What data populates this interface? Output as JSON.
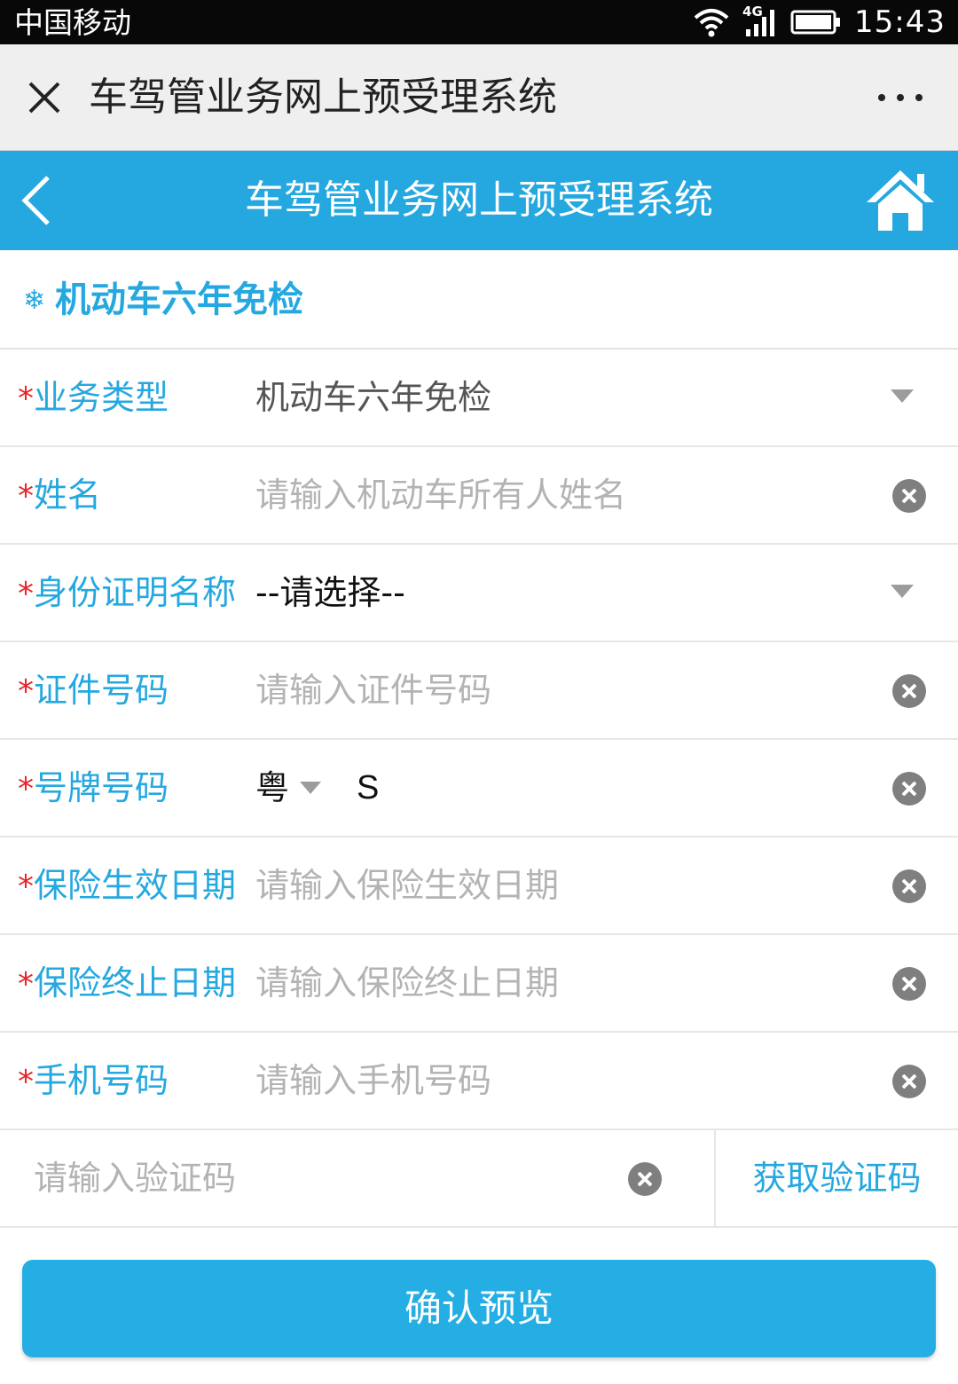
{
  "status_bar": {
    "carrier": "中国移动",
    "network": "4G",
    "time": "15:43",
    "icons": [
      "wifi-icon",
      "signal-icon",
      "battery-icon"
    ]
  },
  "wechat_bar": {
    "title": "车驾管业务网上预受理系统",
    "close_icon": "close-icon",
    "more_icon": "more-icon"
  },
  "app_header": {
    "title": "车驾管业务网上预受理系统",
    "back_icon": "chevron-left-icon",
    "home_icon": "home-icon",
    "color": "#25a8e0"
  },
  "section": {
    "icon": "❄",
    "title": "机动车六年免检"
  },
  "form": {
    "required_mark": "*",
    "business_type": {
      "label": "业务类型",
      "value": "机动车六年免检"
    },
    "name": {
      "label": "姓名",
      "placeholder": "请输入机动车所有人姓名"
    },
    "id_type": {
      "label": "身份证明名称",
      "value": "--请选择--"
    },
    "id_number": {
      "label": "证件号码",
      "placeholder": "请输入证件号码"
    },
    "plate": {
      "label": "号牌号码",
      "province": "粤",
      "value": "S"
    },
    "insurance_start": {
      "label": "保险生效日期",
      "placeholder": "请输入保险生效日期"
    },
    "insurance_end": {
      "label": "保险终止日期",
      "placeholder": "请输入保险终止日期"
    },
    "phone": {
      "label": "手机号码",
      "placeholder": "请输入手机号码"
    },
    "verify_code": {
      "placeholder": "请输入验证码",
      "button": "获取验证码"
    }
  },
  "submit": {
    "label": "确认预览"
  },
  "colors": {
    "accent": "#25a8e0",
    "required": "#e8262a",
    "placeholder": "#b3b3b3"
  }
}
